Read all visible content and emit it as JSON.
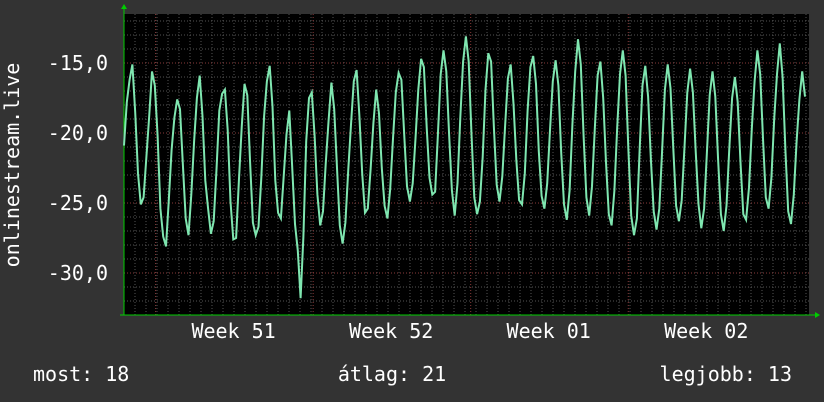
{
  "chart_data": {
    "type": "line",
    "ylabel": "onlinestream.live",
    "ylim": [
      -33,
      -11.5
    ],
    "y_ticks": [
      {
        "value": -15,
        "label": "-15,0"
      },
      {
        "value": -20,
        "label": "-20,0"
      },
      {
        "value": -25,
        "label": "-25,0"
      },
      {
        "value": -30,
        "label": "-30,0"
      }
    ],
    "x_ticks": [
      "Week 51",
      "Week 52",
      "Week 01",
      "Week 02"
    ],
    "grid": true,
    "colors": {
      "background": "#333333",
      "plot_background": "#000000",
      "grid": "#555555",
      "line": "#7fe6b0",
      "axis_arrow": "#00cc00"
    },
    "series": [
      {
        "values": [
          -20.9,
          -17.8,
          -16.2,
          -15.1,
          -18.5,
          -22.9,
          -25.1,
          -24.6,
          -21.7,
          -18.8,
          -15.6,
          -16.6,
          -20.2,
          -25.4,
          -27.4,
          -28.1,
          -24.8,
          -21.2,
          -18.9,
          -17.6,
          -18.3,
          -22.3,
          -26.1,
          -27.3,
          -24.4,
          -20.6,
          -17.5,
          -15.9,
          -18.8,
          -23.4,
          -25.4,
          -27.2,
          -26.3,
          -22.6,
          -18.4,
          -17.2,
          -16.9,
          -19.8,
          -24.9,
          -27.6,
          -27.5,
          -23.4,
          -19.6,
          -16.5,
          -17.3,
          -22.1,
          -26.4,
          -27.3,
          -26.7,
          -23.2,
          -18.8,
          -16.3,
          -15.2,
          -18.1,
          -23.4,
          -25.7,
          -26.1,
          -23.1,
          -20.1,
          -18.4,
          -22.3,
          -26.5,
          -28.4,
          -31.8,
          -27.4,
          -20.6,
          -17.5,
          -17.1,
          -20.2,
          -24.4,
          -26.6,
          -25.6,
          -22.1,
          -19.1,
          -16.4,
          -18.3,
          -22.5,
          -26.6,
          -27.9,
          -26.4,
          -22.7,
          -19.4,
          -16.3,
          -15.5,
          -18.8,
          -22.9,
          -25.7,
          -25.4,
          -22.6,
          -19.3,
          -16.9,
          -18.6,
          -22.5,
          -25.2,
          -26.1,
          -24.0,
          -20.4,
          -17.1,
          -15.7,
          -16.2,
          -20.1,
          -23.8,
          -24.9,
          -23.6,
          -20.4,
          -16.9,
          -14.7,
          -15.3,
          -19.6,
          -23.2,
          -24.4,
          -24.2,
          -20.1,
          -15.8,
          -14.1,
          -15.6,
          -20.1,
          -24.1,
          -25.9,
          -23.6,
          -18.9,
          -14.9,
          -13.1,
          -14.9,
          -20.1,
          -24.6,
          -25.8,
          -24.9,
          -21.7,
          -16.9,
          -14.3,
          -14.9,
          -19.6,
          -23.7,
          -24.9,
          -23.1,
          -19.5,
          -16.1,
          -15.1,
          -17.9,
          -21.9,
          -24.8,
          -25.1,
          -22.9,
          -18.4,
          -15.3,
          -14.5,
          -16.5,
          -21.3,
          -24.5,
          -25.4,
          -23.6,
          -19.8,
          -16.3,
          -14.8,
          -16.6,
          -21.4,
          -25.1,
          -26.2,
          -24.1,
          -19.4,
          -15.6,
          -13.3,
          -15.1,
          -20.2,
          -24.6,
          -25.9,
          -23.8,
          -19.7,
          -15.9,
          -14.9,
          -17.5,
          -22.1,
          -25.8,
          -26.6,
          -24.1,
          -19.6,
          -15.8,
          -14.1,
          -15.9,
          -21.2,
          -25.9,
          -27.3,
          -26.1,
          -21.1,
          -16.6,
          -15.2,
          -17.4,
          -21.9,
          -25.6,
          -26.9,
          -25.4,
          -21.3,
          -16.9,
          -15.1,
          -16.8,
          -21.1,
          -25.2,
          -26.3,
          -24.8,
          -21.0,
          -17.1,
          -15.4,
          -17.1,
          -21.3,
          -25.1,
          -26.8,
          -25.4,
          -21.4,
          -17.3,
          -15.6,
          -17.4,
          -21.9,
          -25.8,
          -27.0,
          -25.2,
          -21.1,
          -17.5,
          -16.0,
          -17.8,
          -22.1,
          -25.8,
          -26.2,
          -23.9,
          -19.7,
          -16.3,
          -14.1,
          -15.8,
          -20.4,
          -24.6,
          -25.4,
          -23.2,
          -19.0,
          -15.8,
          -13.6,
          -16.0,
          -21.2,
          -25.6,
          -26.5,
          -24.4,
          -20.6,
          -17.6,
          -15.6,
          -17.4
        ]
      }
    ]
  },
  "stats": {
    "current": "most: 18",
    "average": "átlag: 21",
    "best": "legjobb: 13"
  }
}
